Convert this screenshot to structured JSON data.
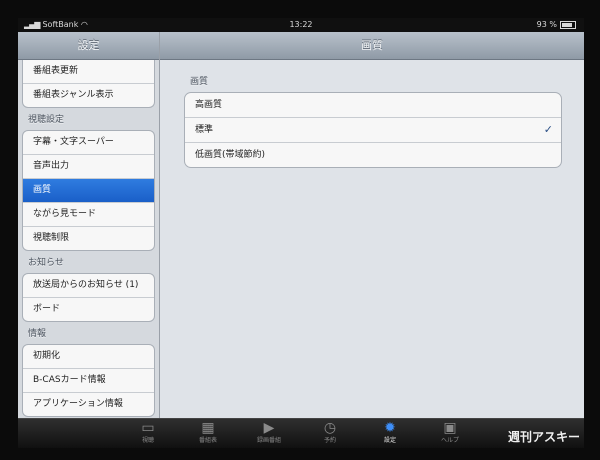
{
  "status": {
    "carrier": "SoftBank",
    "time": "13:22",
    "battery": "93 %"
  },
  "sidebar": {
    "title": "設定",
    "group1": [
      {
        "label": "番組表更新"
      },
      {
        "label": "番組表ジャンル表示"
      }
    ],
    "section_viewing": "視聴設定",
    "viewing_items": [
      {
        "label": "字幕・文字スーパー"
      },
      {
        "label": "音声出力"
      },
      {
        "label": "画質"
      },
      {
        "label": "ながら見モード"
      },
      {
        "label": "視聴制限"
      }
    ],
    "section_notice": "お知らせ",
    "notice_items": [
      {
        "label": "放送局からのお知らせ (1)"
      },
      {
        "label": "ボード"
      }
    ],
    "section_info": "情報",
    "info_items": [
      {
        "label": "初期化"
      },
      {
        "label": "B-CASカード情報"
      },
      {
        "label": "アプリケーション情報"
      }
    ]
  },
  "detail": {
    "title": "画質",
    "section": "画質",
    "options": [
      {
        "label": "高画質"
      },
      {
        "label": "標準"
      },
      {
        "label": "低画質(帯域節約)"
      }
    ],
    "checkmark": "✓"
  },
  "tabbar": {
    "tabs": [
      {
        "label": "視聴",
        "icon": "tv-icon"
      },
      {
        "label": "番組表",
        "icon": "grid-icon"
      },
      {
        "label": "録画番組",
        "icon": "play-icon"
      },
      {
        "label": "予約",
        "icon": "clock-icon"
      },
      {
        "label": "設定",
        "icon": "gear-icon"
      },
      {
        "label": "ヘルプ",
        "icon": "help-icon"
      }
    ]
  },
  "watermark": "週刊アスキー",
  "colors": {
    "selected_row": "#1f6bd6",
    "active_tab": "#3e8ef7",
    "check": "#2b4f86"
  }
}
